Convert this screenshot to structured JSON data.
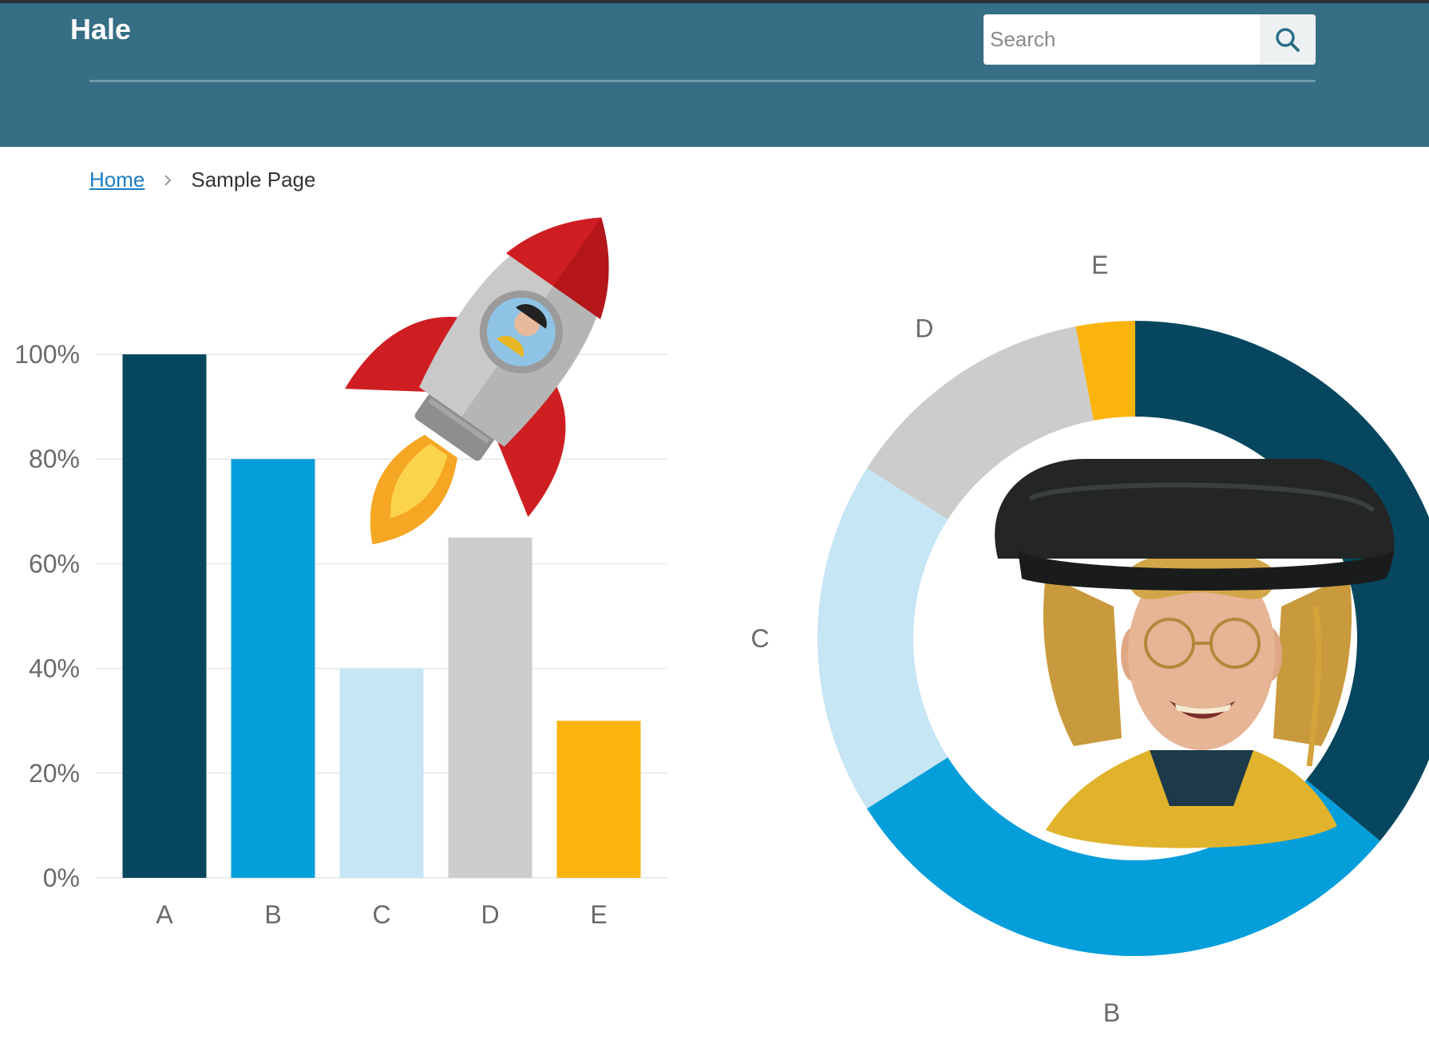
{
  "header": {
    "site_title": "Hale",
    "search_placeholder": "Search"
  },
  "breadcrumb": {
    "home": "Home",
    "current": "Sample Page"
  },
  "icons": {
    "search": "search-icon",
    "separator": "chevron-right-icon",
    "rocket": "rocket-icon"
  },
  "colors": {
    "header_bg": "#356e85",
    "A": "#06475f",
    "B": "#049edb",
    "C": "#c6e5f5",
    "D": "#cccccc",
    "E": "#fbb40b"
  },
  "chart_data": [
    {
      "type": "bar",
      "categories": [
        "A",
        "B",
        "C",
        "D",
        "E"
      ],
      "values": [
        100,
        80,
        40,
        65,
        30
      ],
      "y_ticks": [
        "0%",
        "20%",
        "40%",
        "60%",
        "80%",
        "100%"
      ],
      "ylim": [
        0,
        100
      ],
      "grid": true
    },
    {
      "type": "pie",
      "style": "donut",
      "labels": [
        "A",
        "B",
        "C",
        "D",
        "E"
      ],
      "visible_labels": [
        "B",
        "C",
        "D",
        "E"
      ],
      "values": [
        36,
        30,
        18,
        13,
        3
      ]
    }
  ]
}
